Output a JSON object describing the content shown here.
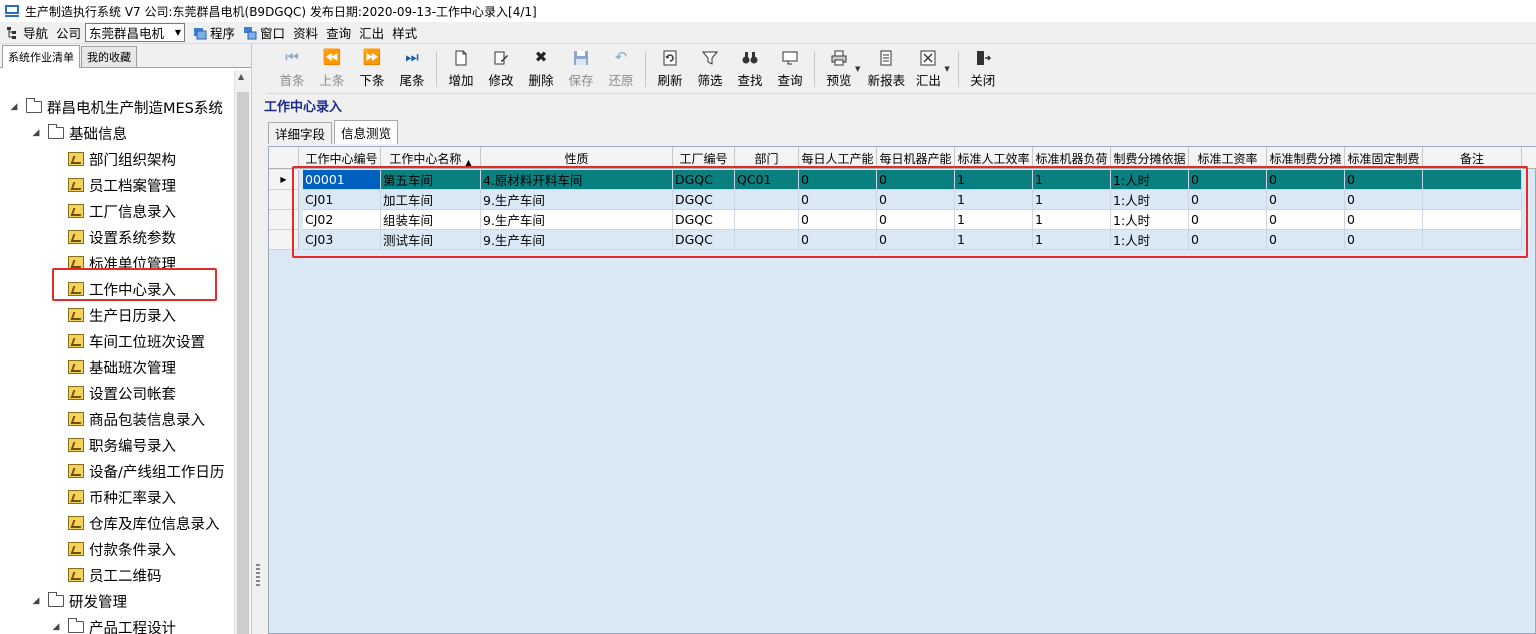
{
  "window": {
    "title": "生产制造执行系统 V7 公司:东莞群昌电机(B9DGQC) 发布日期:2020-09-13-工作中心录入[4/1]"
  },
  "menubar": {
    "nav": "导航",
    "company_label": "公司",
    "company_value": "东莞群昌电机",
    "program": "程序",
    "window": "窗口",
    "data": "资料",
    "query": "查询",
    "export": "汇出",
    "style": "样式"
  },
  "left_tabs": {
    "system_list": "系统作业清单",
    "favorites": "我的收藏"
  },
  "tree": {
    "root": "群昌电机生产制造MES系统",
    "basic_info": "基础信息",
    "items": [
      "部门组织架构",
      "员工档案管理",
      "工厂信息录入",
      "设置系统参数",
      "标准单位管理",
      "工作中心录入",
      "生产日历录入",
      "车间工位班次设置",
      "基础班次管理",
      "设置公司帐套",
      "商品包装信息录入",
      "职务编号录入",
      "设备/产线组工作日历",
      "币种汇率录入",
      "仓库及库位信息录入",
      "付款条件录入",
      "员工二维码"
    ],
    "rd": "研发管理",
    "product_design": "产品工程设计"
  },
  "toolbar": {
    "first": "首条",
    "prev": "上条",
    "next": "下条",
    "last": "尾条",
    "add": "增加",
    "edit": "修改",
    "delete": "删除",
    "save": "保存",
    "restore": "还原",
    "refresh": "刷新",
    "filter": "筛选",
    "find": "查找",
    "query": "查询",
    "preview": "预览",
    "new_report": "新报表",
    "export": "汇出",
    "close": "关闭"
  },
  "content": {
    "title": "工作中心录入",
    "tab_detail": "详细字段",
    "tab_browse": "信息测览"
  },
  "grid": {
    "columns": [
      "工作中心编号",
      "工作中心名称",
      "性质",
      "工厂编号",
      "部门",
      "每日人工产能",
      "每日机器产能",
      "标准人工效率",
      "标准机器负荷",
      "制费分摊依据",
      "标准工资率",
      "标准制费分摊",
      "标准固定制费",
      "备注"
    ],
    "rows": [
      [
        "00001",
        "第五车间",
        "4.原材料开料车间",
        "DGQC",
        "QC01",
        "0",
        "0",
        "1",
        "1",
        "1:人时",
        "0",
        "0",
        "0",
        ""
      ],
      [
        "CJ01",
        "加工车间",
        "9.生产车间",
        "DGQC",
        "",
        "0",
        "0",
        "1",
        "1",
        "1:人时",
        "0",
        "0",
        "0",
        ""
      ],
      [
        "CJ02",
        "组装车间",
        "9.生产车间",
        "DGQC",
        "",
        "0",
        "0",
        "1",
        "1",
        "1:人时",
        "0",
        "0",
        "0",
        ""
      ],
      [
        "CJ03",
        "测试车间",
        "9.生产车间",
        "DGQC",
        "",
        "0",
        "0",
        "1",
        "1",
        "1:人时",
        "0",
        "0",
        "0",
        ""
      ]
    ]
  },
  "colors": {
    "selected_row": "#0a7f80",
    "highlight_box": "#e52a2a",
    "title_blue": "#1a2a8a"
  }
}
